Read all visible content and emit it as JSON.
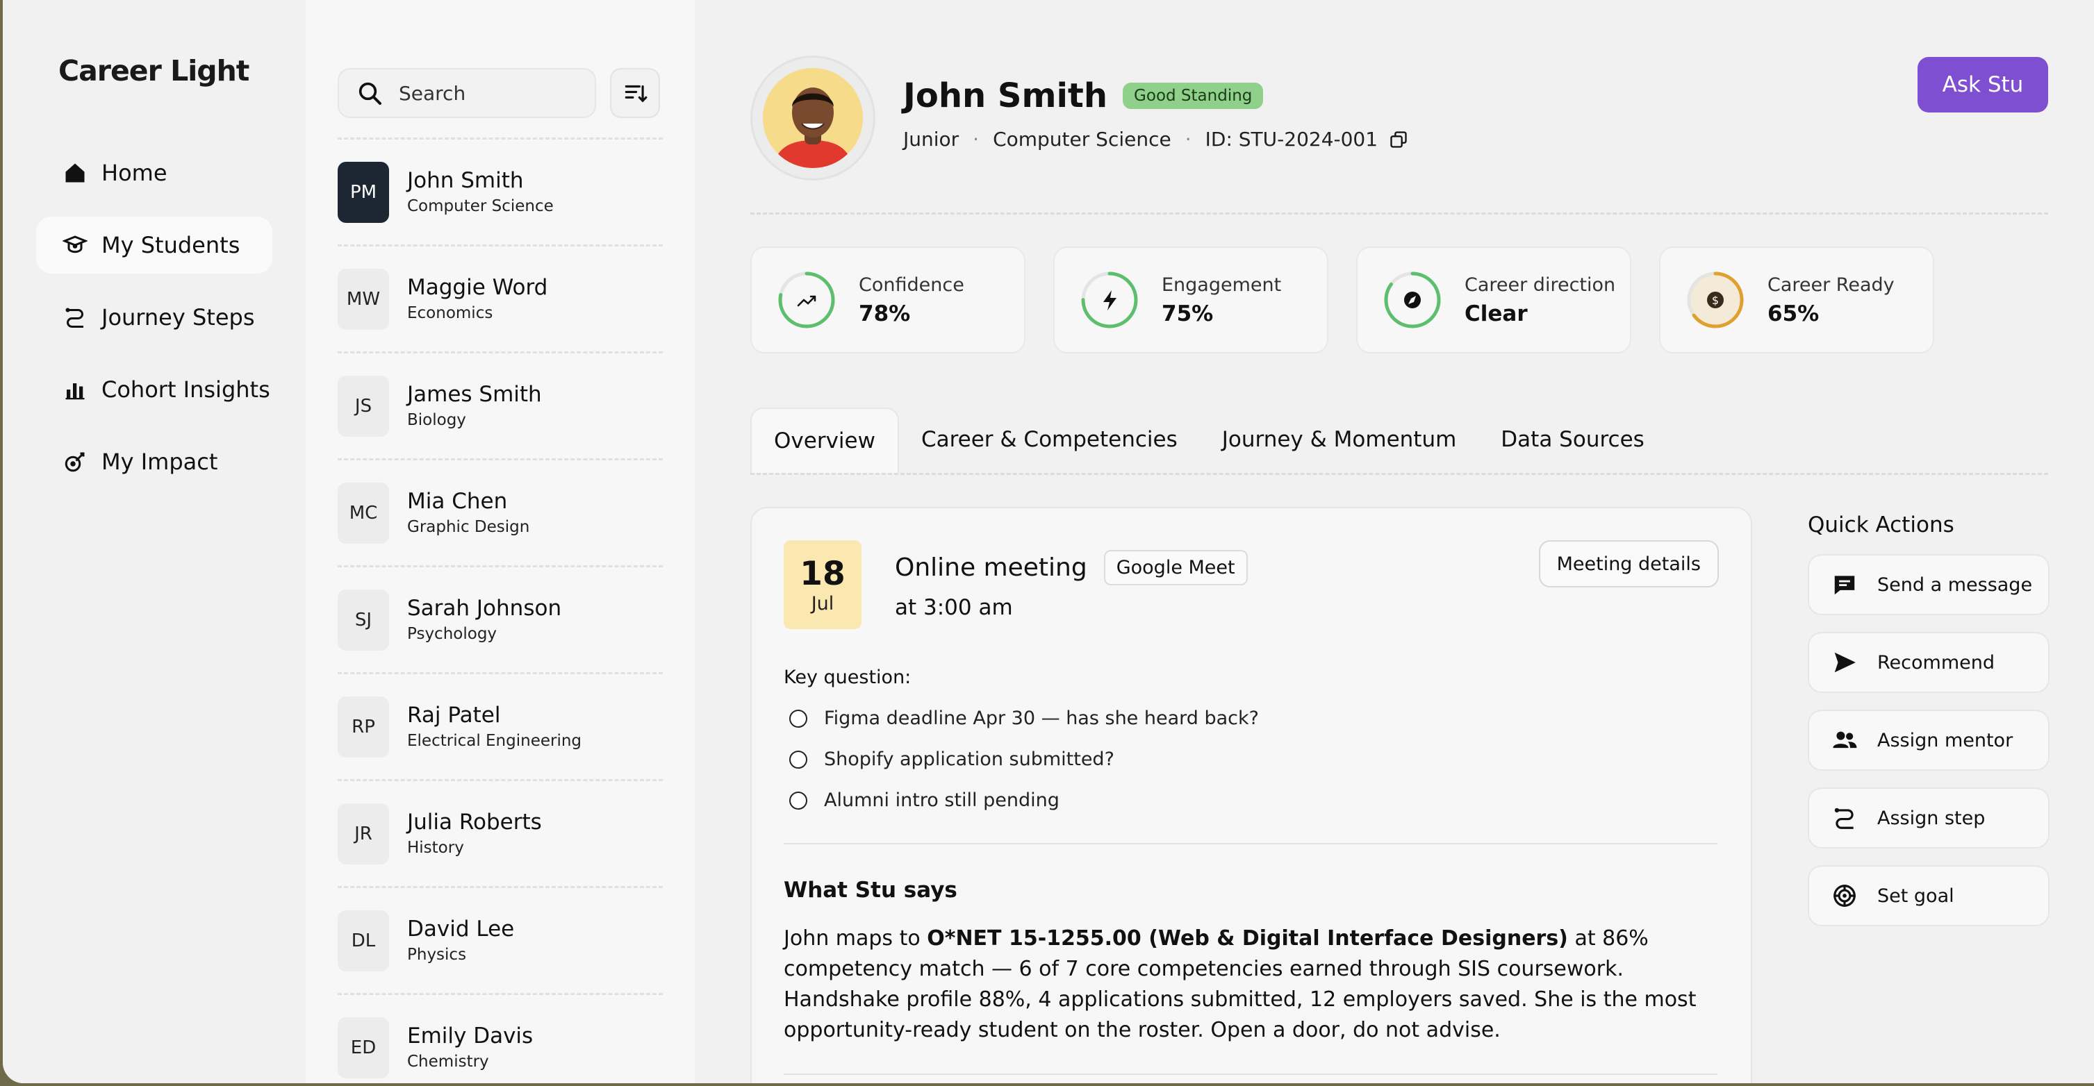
{
  "app": {
    "logo": "Career Light"
  },
  "nav": {
    "items": [
      {
        "label": "Home",
        "icon": "home-icon"
      },
      {
        "label": "My Students",
        "icon": "graduation-icon",
        "active": true
      },
      {
        "label": "Journey Steps",
        "icon": "path-icon"
      },
      {
        "label": "Cohort Insights",
        "icon": "bar-chart-icon"
      },
      {
        "label": "My Impact",
        "icon": "impact-icon"
      }
    ]
  },
  "list": {
    "search_placeholder": "Search",
    "students": [
      {
        "initials": "PM",
        "name": "John Smith",
        "major": "Computer Science",
        "selected": true
      },
      {
        "initials": "MW",
        "name": "Maggie Word",
        "major": "Economics"
      },
      {
        "initials": "JS",
        "name": "James Smith",
        "major": "Biology"
      },
      {
        "initials": "MC",
        "name": "Mia Chen",
        "major": "Graphic Design"
      },
      {
        "initials": "SJ",
        "name": "Sarah Johnson",
        "major": "Psychology"
      },
      {
        "initials": "RP",
        "name": "Raj Patel",
        "major": "Electrical Engineering"
      },
      {
        "initials": "JR",
        "name": "Julia Roberts",
        "major": "History"
      },
      {
        "initials": "DL",
        "name": "David Lee",
        "major": "Physics"
      },
      {
        "initials": "ED",
        "name": "Emily Davis",
        "major": "Chemistry"
      }
    ]
  },
  "profile": {
    "name": "John Smith",
    "status": "Good Standing",
    "year": "Junior",
    "major": "Computer Science",
    "id": "ID: STU-2024-001",
    "ask_button": "Ask Stu"
  },
  "stats": [
    {
      "label": "Confidence",
      "value": "78%",
      "fraction": 0.78,
      "color": "#5bbf6e",
      "icon": "trend-up-icon"
    },
    {
      "label": "Engagement",
      "value": "75%",
      "fraction": 0.75,
      "color": "#5bbf6e",
      "icon": "bolt-icon"
    },
    {
      "label": "Career direction",
      "value": "Clear",
      "fraction": 0.85,
      "color": "#5bbf6e",
      "icon": "compass-icon"
    },
    {
      "label": "Career Ready",
      "value": "65%",
      "fraction": 0.65,
      "color": "#e0a030",
      "icon": "dollar-icon"
    }
  ],
  "tabs": [
    "Overview",
    "Career & Competencies",
    "Journey & Momentum",
    "Data Sources"
  ],
  "meeting": {
    "day": "18",
    "month": "Jul",
    "title": "Online meeting",
    "platform": "Google Meet",
    "time": "at 3:00 am",
    "details_button": "Meeting details",
    "key_question_label": "Key question:",
    "questions": [
      "Figma deadline Apr 30 — has she heard back?",
      "Shopify application submitted?",
      "Alumni intro still pending"
    ]
  },
  "stu_says": {
    "title": "What Stu says",
    "prefix": "John maps to ",
    "highlight": "O*NET 15-1255.00 (Web & Digital Interface Designers)",
    "suffix": " at 86% competency match — 6 of 7 core competencies earned through SIS coursework. Handshake profile 88%, 4 applications submitted, 12 employers saved. She is the most opportunity-ready student on the roster. Open a door, do not advise."
  },
  "quick_actions": {
    "title": "Quick Actions",
    "items": [
      {
        "label": "Send a message",
        "icon": "message-icon"
      },
      {
        "label": "Recommend",
        "icon": "send-icon"
      },
      {
        "label": "Assign mentor",
        "icon": "people-icon"
      },
      {
        "label": "Assign step",
        "icon": "path-icon"
      },
      {
        "label": "Set goal",
        "icon": "target-icon"
      }
    ]
  }
}
